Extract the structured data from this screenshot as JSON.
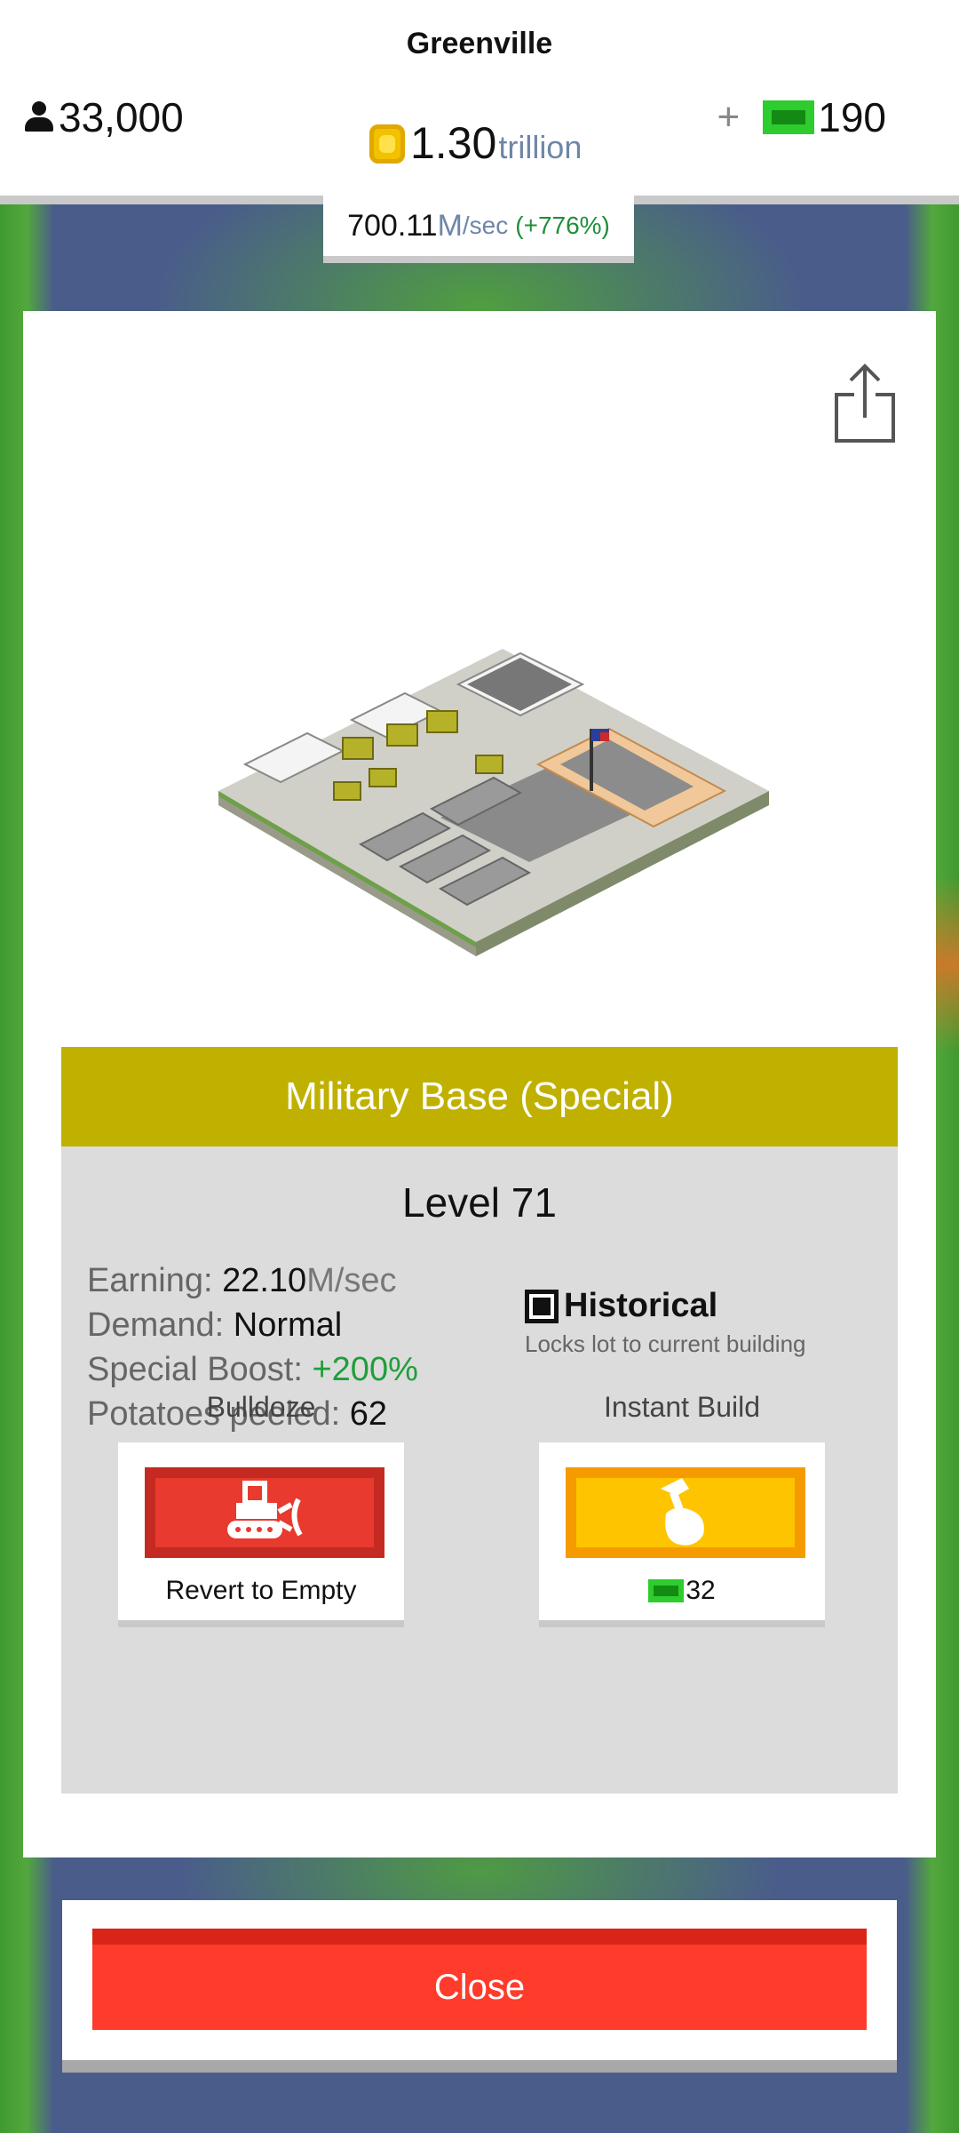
{
  "header": {
    "city_name": "Greenville",
    "population": "33,000",
    "coins_value": "1.30",
    "coins_unit": "trillion",
    "plus_label": "+",
    "bucks": "190"
  },
  "rate": {
    "value": "700.11",
    "unit": "M",
    "unit_suffix": "/sec",
    "change": "(+776%)"
  },
  "building": {
    "title": "Military Base (Special)",
    "level": "Level 71",
    "stats": {
      "earning_label": "Earning: ",
      "earning_value": "22.10",
      "earning_unit": "M/sec",
      "demand_label": "Demand: ",
      "demand_value": "Normal",
      "boost_label": "Special Boost: ",
      "boost_value": "+200%",
      "potatoes_label": "Potatoes peeled: ",
      "potatoes_value": "62"
    },
    "historical": {
      "label": "Historical",
      "description": "Locks lot to current building"
    }
  },
  "actions": {
    "bulldoze_heading": "Bulldoze",
    "bulldoze_caption": "Revert to Empty",
    "instant_heading": "Instant Build",
    "instant_cost": "32"
  },
  "close_label": "Close",
  "icons": {
    "population": "person-icon",
    "coins": "coin-icon",
    "bucks": "cash-icon",
    "share": "share-icon",
    "bulldoze": "bulldozer-icon",
    "instant": "hammer-hand-icon"
  },
  "colors": {
    "title_bar": "#c0b000",
    "bulldoze": "#e83a2e",
    "instant_build": "#ffc400",
    "close": "#ff3b2b",
    "boost": "#1f9e3a"
  }
}
